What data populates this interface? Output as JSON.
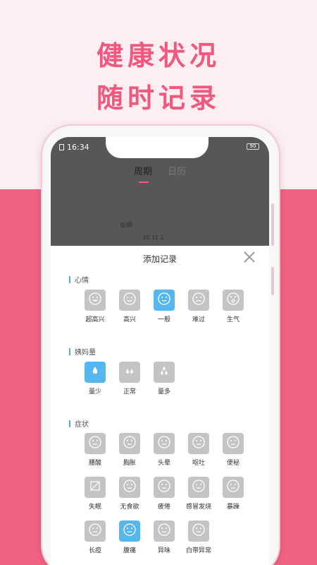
{
  "promo": {
    "line1": "健康状况",
    "line2": "随时记录"
  },
  "status": {
    "time": "16:34",
    "battery": "90"
  },
  "tabs": [
    {
      "label": "周期"
    },
    {
      "label": "日历"
    }
  ],
  "background_text": {
    "calendar_hint": "孕期",
    "calendar_numbers": "30 31 1"
  },
  "sheet": {
    "title": "添加记录",
    "mood": {
      "title": "心情",
      "items": [
        {
          "label": "超高兴",
          "icon": "grin-icon"
        },
        {
          "label": "高兴",
          "icon": "smile-icon"
        },
        {
          "label": "一般",
          "icon": "neutral-face-icon"
        },
        {
          "label": "难过",
          "icon": "sad-face-icon"
        },
        {
          "label": "生气",
          "icon": "angry-face-icon"
        }
      ]
    },
    "flow": {
      "title": "姨妈量",
      "items": [
        {
          "label": "量少",
          "icon": "single-drop-icon"
        },
        {
          "label": "正常",
          "icon": "double-drop-icon"
        },
        {
          "label": "量多",
          "icon": "triple-drop-icon"
        }
      ]
    },
    "symptoms": {
      "title": "症状",
      "items": [
        {
          "label": "腰酸",
          "icon": "backache-icon"
        },
        {
          "label": "胸胀",
          "icon": "chest-icon"
        },
        {
          "label": "头晕",
          "icon": "dizzy-icon"
        },
        {
          "label": "呕吐",
          "icon": "vomit-icon"
        },
        {
          "label": "便秘",
          "icon": "constipation-icon"
        },
        {
          "label": "失眠",
          "icon": "insomnia-icon"
        },
        {
          "label": "无食欲",
          "icon": "no-appetite-icon"
        },
        {
          "label": "疲倦",
          "icon": "tired-icon"
        },
        {
          "label": "感冒发烧",
          "icon": "fever-icon"
        },
        {
          "label": "暴躁",
          "icon": "irritable-icon"
        },
        {
          "label": "长痘",
          "icon": "acne-icon"
        },
        {
          "label": "腹痛",
          "icon": "abdominal-pain-icon"
        },
        {
          "label": "异味",
          "icon": "odor-icon"
        },
        {
          "label": "白带异常",
          "icon": "discharge-icon"
        }
      ]
    }
  },
  "colors": {
    "accent": "#f0587d",
    "band": "#f06282",
    "selected": "#56b7ef",
    "tile": "#c4c4c4",
    "section_bar": "#58a6df"
  }
}
